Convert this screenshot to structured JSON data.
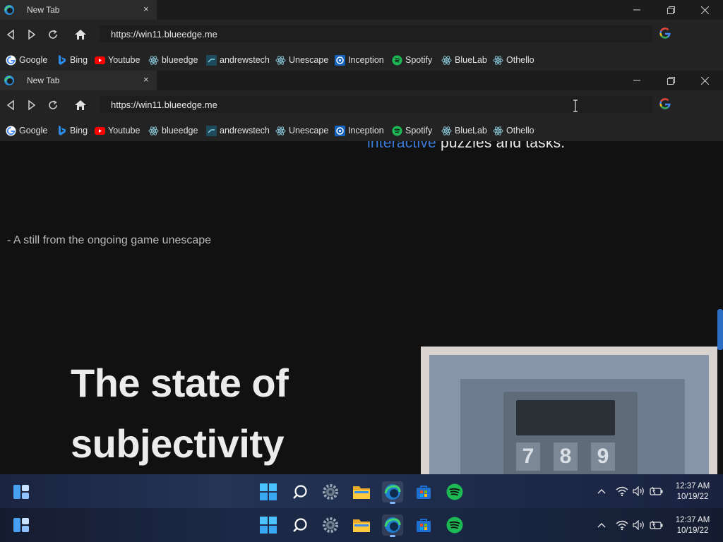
{
  "browser": {
    "tab_title": "New Tab",
    "tab_close": "×",
    "url": "https://win11.blueedge.me",
    "bookmarks": [
      {
        "label": "Google",
        "icon": "google-icon"
      },
      {
        "label": "Bing",
        "icon": "bing-icon"
      },
      {
        "label": "Youtube",
        "icon": "youtube-icon"
      },
      {
        "label": "blueedge",
        "icon": "react-icon"
      },
      {
        "label": "andrewstech",
        "icon": "andrewstech-icon"
      },
      {
        "label": "Unescape",
        "icon": "react-icon"
      },
      {
        "label": "Inception",
        "icon": "inception-icon"
      },
      {
        "label": "Spotify",
        "icon": "spotify-icon"
      },
      {
        "label": "BlueLab",
        "icon": "react-icon"
      },
      {
        "label": "Othello",
        "icon": "react-icon"
      }
    ]
  },
  "page": {
    "headline_accent": "interactive",
    "headline_rest": " puzzles and tasks.",
    "caption": "- A still from the ongoing game unescape",
    "title_line1": "The state of",
    "title_line2": "subjectivity",
    "keypad_keys": [
      "7",
      "8",
      "9"
    ]
  },
  "taskbar": {
    "time": "12:37 AM",
    "date": "10/19/22",
    "tray_chevron": "^"
  },
  "colors": {
    "accent": "#3d7ad6",
    "spotify": "#1db954",
    "youtube": "#ff0000",
    "edge": "#2a8fd8"
  }
}
